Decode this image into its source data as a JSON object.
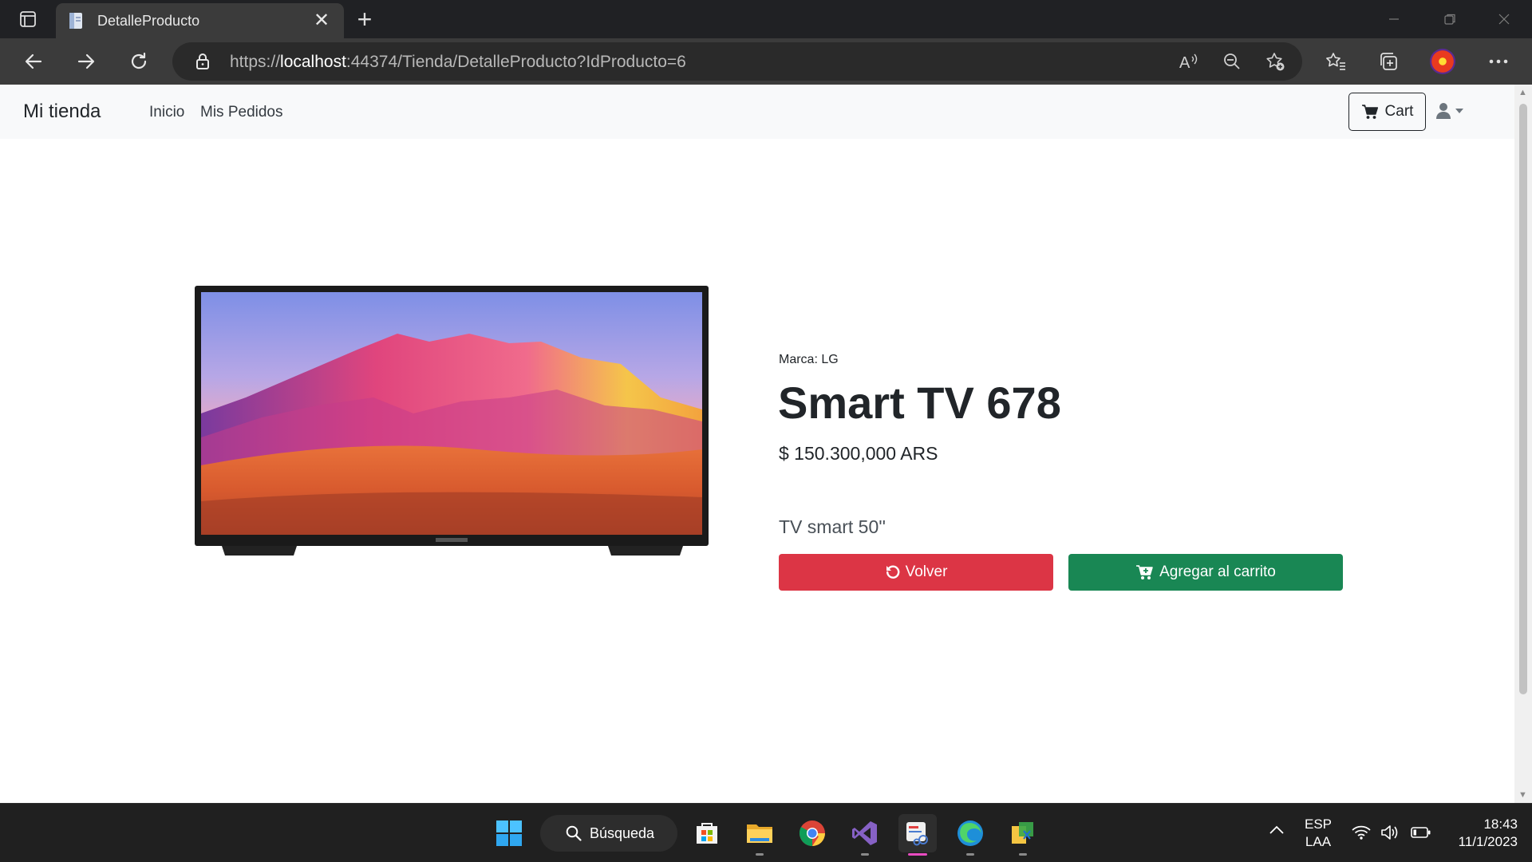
{
  "browser": {
    "tab_title": "DetalleProducto",
    "url_scheme": "https://",
    "url_host": "localhost",
    "url_rest": ":44374/Tienda/DetalleProducto?IdProducto=6"
  },
  "site": {
    "brand": "Mi tienda",
    "nav": [
      "Inicio",
      "Mis Pedidos"
    ],
    "cart_label": "Cart"
  },
  "product": {
    "brand_label": "Marca: LG",
    "name": "Smart TV 678",
    "price": "$ 150.300,000 ARS",
    "description": "TV smart 50''",
    "back_label": "Volver",
    "add_label": "Agregar al carrito"
  },
  "taskbar": {
    "search_label": "Búsqueda",
    "lang_top": "ESP",
    "lang_bottom": "LAA",
    "time": "18:43",
    "date": "11/1/2023"
  },
  "colors": {
    "danger": "#dc3545",
    "success": "#198754",
    "chrome_dark": "#202124"
  }
}
